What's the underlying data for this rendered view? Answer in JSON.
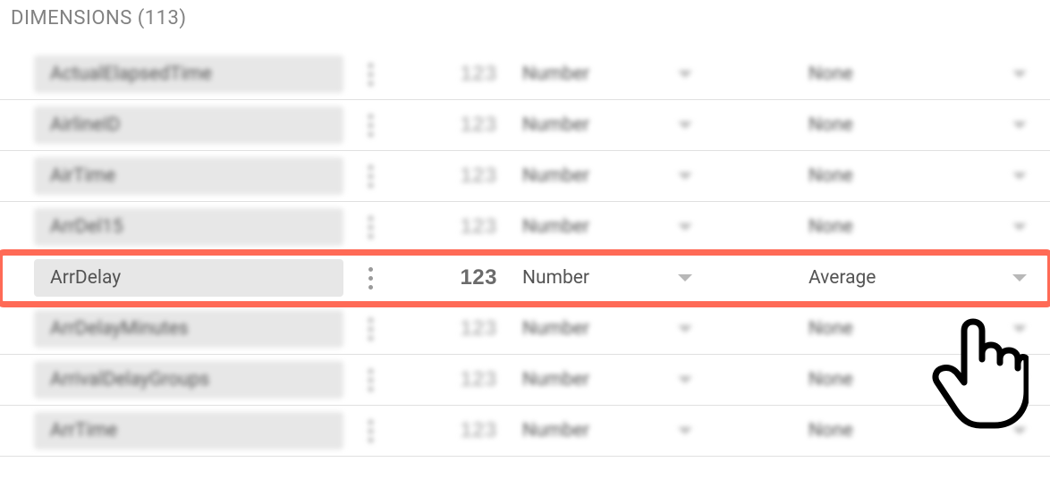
{
  "section": {
    "title_prefix": "DIMENSIONS",
    "count": 113
  },
  "type_icon_glyph": "123",
  "rows": [
    {
      "name": "ActualElapsedTime",
      "type": "Number",
      "agg": "None",
      "focused": false
    },
    {
      "name": "AirlineID",
      "type": "Number",
      "agg": "None",
      "focused": false
    },
    {
      "name": "AirTime",
      "type": "Number",
      "agg": "None",
      "focused": false
    },
    {
      "name": "ArrDel15",
      "type": "Number",
      "agg": "None",
      "focused": false
    },
    {
      "name": "ArrDelay",
      "type": "Number",
      "agg": "Average",
      "focused": true
    },
    {
      "name": "ArrDelayMinutes",
      "type": "Number",
      "agg": "None",
      "focused": false
    },
    {
      "name": "ArrivalDelayGroups",
      "type": "Number",
      "agg": "None",
      "focused": false
    },
    {
      "name": "ArrTime",
      "type": "Number",
      "agg": "None",
      "focused": false
    }
  ]
}
